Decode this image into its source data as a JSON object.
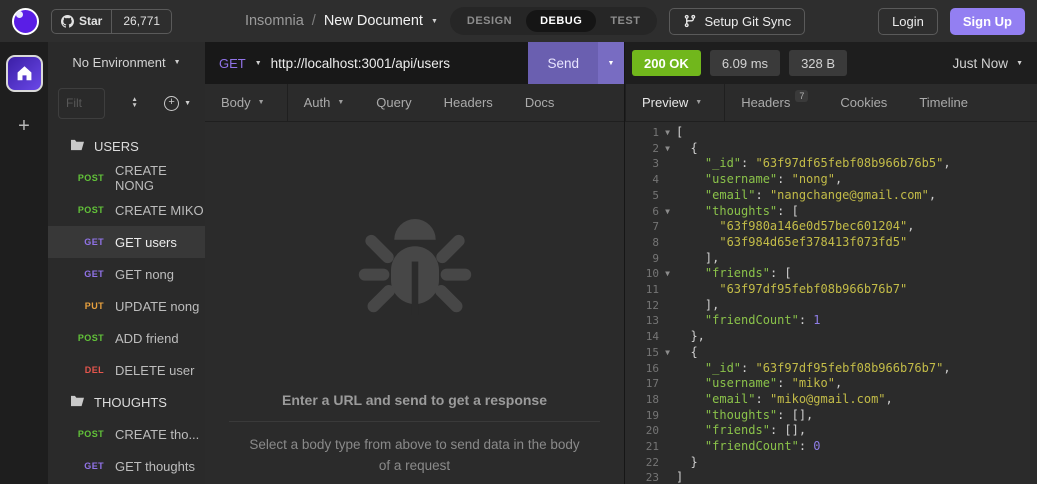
{
  "icons": {
    "caret_down": "▼",
    "sort_up": "▲",
    "sort_down": "▼",
    "plus": "+"
  },
  "colors": {
    "signup": "#937ff2",
    "status_ok": "#71b71c",
    "method_get": "#9173e8",
    "method_post": "#62c339",
    "method_put": "#e9a13e",
    "method_del": "#e5564d",
    "token_key": "#8ac24a",
    "token_string": "#c3bc48",
    "token_number": "#8f7ee8",
    "token_plain": "#cfcfcf"
  },
  "topbar": {
    "github": {
      "star_label": "Star",
      "count": "26,771"
    },
    "breadcrumb": {
      "app": "Insomnia",
      "separator": "/",
      "document": "New Document"
    },
    "mode_tabs": [
      {
        "label": "DESIGN",
        "active": false
      },
      {
        "label": "DEBUG",
        "active": true
      },
      {
        "label": "TEST",
        "active": false
      }
    ],
    "git_sync_label": "Setup Git Sync",
    "login_label": "Login",
    "signup_label": "Sign Up"
  },
  "sidebar": {
    "environment_label": "No Environment",
    "filter_placeholder": "Filt",
    "items": [
      {
        "type": "folder",
        "label": "USERS"
      },
      {
        "type": "request",
        "method": "POST",
        "label": "CREATE NONG"
      },
      {
        "type": "request",
        "method": "POST",
        "label": "CREATE MIKO"
      },
      {
        "type": "request",
        "method": "GET",
        "label": "GET users",
        "selected": true
      },
      {
        "type": "request",
        "method": "GET",
        "label": "GET nong"
      },
      {
        "type": "request",
        "method": "PUT",
        "label": "UPDATE nong"
      },
      {
        "type": "request",
        "method": "POST",
        "label": "ADD friend"
      },
      {
        "type": "request",
        "method": "DEL",
        "label": "DELETE user"
      },
      {
        "type": "folder",
        "label": "THOUGHTS"
      },
      {
        "type": "request",
        "method": "POST",
        "label": "CREATE tho..."
      },
      {
        "type": "request",
        "method": "GET",
        "label": "GET thoughts"
      }
    ]
  },
  "request": {
    "method": "GET",
    "url": "http://localhost:3001/api/users",
    "send_label": "Send",
    "tabs": [
      {
        "label": "Body",
        "caret": true,
        "divider": true
      },
      {
        "label": "Auth",
        "caret": true
      },
      {
        "label": "Query"
      },
      {
        "label": "Headers"
      },
      {
        "label": "Docs"
      }
    ],
    "empty": {
      "title": "Enter a URL and send to get a response",
      "subtitle": "Select a body type from above to send data in the body of a request"
    }
  },
  "response": {
    "status": "200 OK",
    "time": "6.09 ms",
    "size": "328 B",
    "history_label": "Just Now",
    "tabs": [
      {
        "label": "Preview",
        "caret": true,
        "active": true,
        "divider": true
      },
      {
        "label": "Headers",
        "badge": "7"
      },
      {
        "label": "Cookies"
      },
      {
        "label": "Timeline"
      }
    ],
    "body": {
      "language": "json",
      "lines": [
        {
          "n": 1,
          "fold": true,
          "t": [
            [
              "[",
              "p"
            ]
          ]
        },
        {
          "n": 2,
          "fold": true,
          "t": [
            [
              "  {",
              "p"
            ]
          ]
        },
        {
          "n": 3,
          "fold": false,
          "t": [
            [
              "    ",
              "p"
            ],
            [
              "\"_id\"",
              "k"
            ],
            [
              ": ",
              "p"
            ],
            [
              "\"63f97df65febf08b966b76b5\"",
              "s"
            ],
            [
              ",",
              "p"
            ]
          ]
        },
        {
          "n": 4,
          "fold": false,
          "t": [
            [
              "    ",
              "p"
            ],
            [
              "\"username\"",
              "k"
            ],
            [
              ": ",
              "p"
            ],
            [
              "\"nong\"",
              "s"
            ],
            [
              ",",
              "p"
            ]
          ]
        },
        {
          "n": 5,
          "fold": false,
          "t": [
            [
              "    ",
              "p"
            ],
            [
              "\"email\"",
              "k"
            ],
            [
              ": ",
              "p"
            ],
            [
              "\"nangchange@gmail.com\"",
              "s"
            ],
            [
              ",",
              "p"
            ]
          ]
        },
        {
          "n": 6,
          "fold": true,
          "t": [
            [
              "    ",
              "p"
            ],
            [
              "\"thoughts\"",
              "k"
            ],
            [
              ": [",
              "p"
            ]
          ]
        },
        {
          "n": 7,
          "fold": false,
          "t": [
            [
              "      ",
              "p"
            ],
            [
              "\"63f980a146e0d57bec601204\"",
              "s"
            ],
            [
              ",",
              "p"
            ]
          ]
        },
        {
          "n": 8,
          "fold": false,
          "t": [
            [
              "      ",
              "p"
            ],
            [
              "\"63f984d65ef378413f073fd5\"",
              "s"
            ]
          ]
        },
        {
          "n": 9,
          "fold": false,
          "t": [
            [
              "    ],",
              "p"
            ]
          ]
        },
        {
          "n": 10,
          "fold": true,
          "t": [
            [
              "    ",
              "p"
            ],
            [
              "\"friends\"",
              "k"
            ],
            [
              ": [",
              "p"
            ]
          ]
        },
        {
          "n": 11,
          "fold": false,
          "t": [
            [
              "      ",
              "p"
            ],
            [
              "\"63f97df95febf08b966b76b7\"",
              "s"
            ]
          ]
        },
        {
          "n": 12,
          "fold": false,
          "t": [
            [
              "    ],",
              "p"
            ]
          ]
        },
        {
          "n": 13,
          "fold": false,
          "t": [
            [
              "    ",
              "p"
            ],
            [
              "\"friendCount\"",
              "k"
            ],
            [
              ": ",
              "p"
            ],
            [
              "1",
              "n"
            ]
          ]
        },
        {
          "n": 14,
          "fold": false,
          "t": [
            [
              "  },",
              "p"
            ]
          ]
        },
        {
          "n": 15,
          "fold": true,
          "t": [
            [
              "  {",
              "p"
            ]
          ]
        },
        {
          "n": 16,
          "fold": false,
          "t": [
            [
              "    ",
              "p"
            ],
            [
              "\"_id\"",
              "k"
            ],
            [
              ": ",
              "p"
            ],
            [
              "\"63f97df95febf08b966b76b7\"",
              "s"
            ],
            [
              ",",
              "p"
            ]
          ]
        },
        {
          "n": 17,
          "fold": false,
          "t": [
            [
              "    ",
              "p"
            ],
            [
              "\"username\"",
              "k"
            ],
            [
              ": ",
              "p"
            ],
            [
              "\"miko\"",
              "s"
            ],
            [
              ",",
              "p"
            ]
          ]
        },
        {
          "n": 18,
          "fold": false,
          "t": [
            [
              "    ",
              "p"
            ],
            [
              "\"email\"",
              "k"
            ],
            [
              ": ",
              "p"
            ],
            [
              "\"miko@gmail.com\"",
              "s"
            ],
            [
              ",",
              "p"
            ]
          ]
        },
        {
          "n": 19,
          "fold": false,
          "t": [
            [
              "    ",
              "p"
            ],
            [
              "\"thoughts\"",
              "k"
            ],
            [
              ": [],",
              "p"
            ]
          ]
        },
        {
          "n": 20,
          "fold": false,
          "t": [
            [
              "    ",
              "p"
            ],
            [
              "\"friends\"",
              "k"
            ],
            [
              ": [],",
              "p"
            ]
          ]
        },
        {
          "n": 21,
          "fold": false,
          "t": [
            [
              "    ",
              "p"
            ],
            [
              "\"friendCount\"",
              "k"
            ],
            [
              ": ",
              "p"
            ],
            [
              "0",
              "n"
            ]
          ]
        },
        {
          "n": 22,
          "fold": false,
          "t": [
            [
              "  }",
              "p"
            ]
          ]
        },
        {
          "n": 23,
          "fold": false,
          "t": [
            [
              "]",
              "p"
            ]
          ]
        }
      ]
    }
  }
}
